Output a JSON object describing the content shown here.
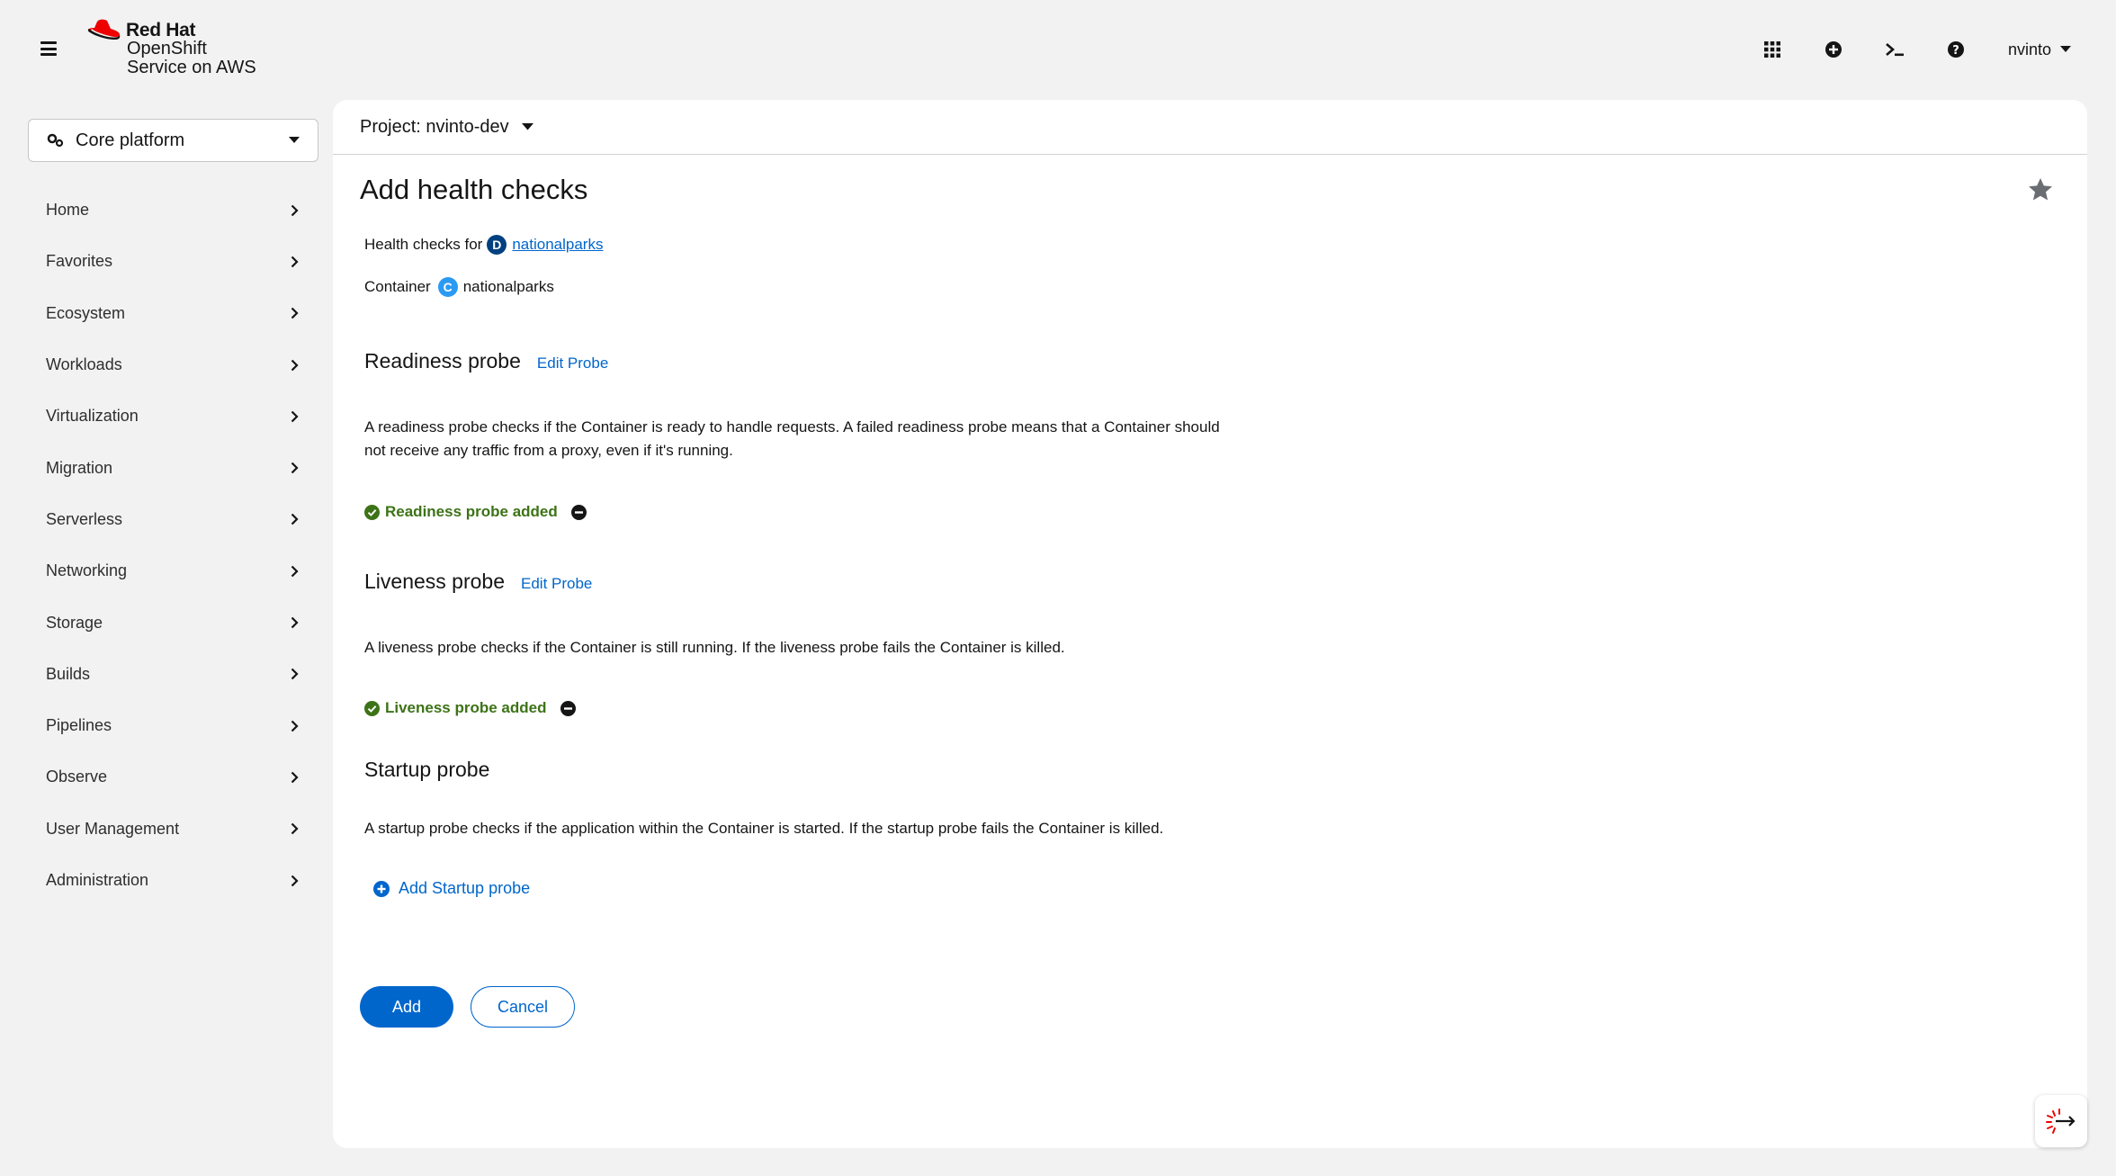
{
  "brand": {
    "company": "Red Hat",
    "product_line1": "OpenShift",
    "product_line2": "Service on AWS",
    "logo_color": "#ee0000"
  },
  "masthead": {
    "icons": [
      "app-launcher-icon",
      "import-plus-icon",
      "terminal-icon",
      "help-icon"
    ],
    "user": "nvinto"
  },
  "perspective": {
    "label": "Core platform",
    "icon": "cogs-icon"
  },
  "nav": {
    "items": [
      {
        "label": "Home"
      },
      {
        "label": "Favorites"
      },
      {
        "label": "Ecosystem"
      },
      {
        "label": "Workloads"
      },
      {
        "label": "Virtualization"
      },
      {
        "label": "Migration"
      },
      {
        "label": "Serverless"
      },
      {
        "label": "Networking"
      },
      {
        "label": "Storage"
      },
      {
        "label": "Builds"
      },
      {
        "label": "Pipelines"
      },
      {
        "label": "Observe"
      },
      {
        "label": "User Management"
      },
      {
        "label": "Administration"
      }
    ]
  },
  "project": {
    "label": "Project: nvinto-dev"
  },
  "page": {
    "title": "Add health checks",
    "health_checks_for_label": "Health checks for",
    "deployment_badge": "D",
    "deployment_name": "nationalparks",
    "container_label": "Container",
    "container_badge": "C",
    "container_name": "nationalparks"
  },
  "readiness": {
    "title": "Readiness probe",
    "edit_label": "Edit Probe",
    "description": "A readiness probe checks if the Container is ready to handle requests. A failed readiness probe means that a Container should not receive any traffic from a proxy, even if it's running.",
    "status": "Readiness probe added"
  },
  "liveness": {
    "title": "Liveness probe",
    "edit_label": "Edit Probe",
    "description": "A liveness probe checks if the Container is still running. If the liveness probe fails the Container is killed.",
    "status": "Liveness probe added"
  },
  "startup": {
    "title": "Startup probe",
    "description": "A startup probe checks if the application within the Container is started. If the startup probe fails the Container is killed.",
    "add_label": "Add Startup probe"
  },
  "actions": {
    "add_label": "Add",
    "cancel_label": "Cancel"
  },
  "colors": {
    "link": "#0066cc",
    "success": "#3d7317",
    "deployment_badge": "#004080",
    "container_badge": "#2b9af3"
  }
}
